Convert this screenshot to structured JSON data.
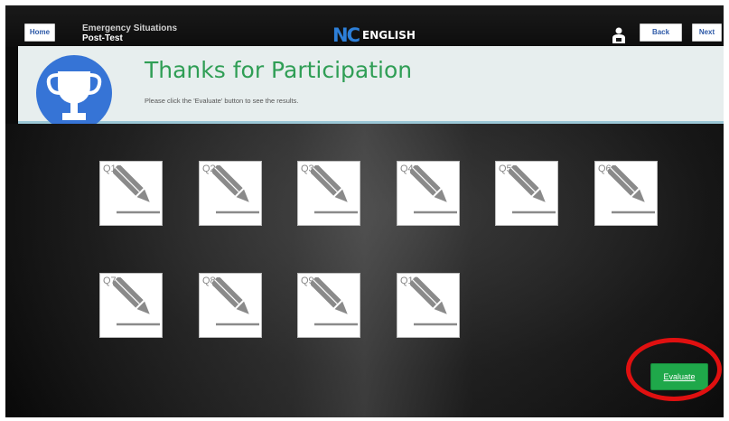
{
  "topbar": {
    "home_label": "Home",
    "course_title": "Emergency Situations",
    "course_sub": "Post-Test",
    "logo_mark": "NC",
    "logo_text": "ENGLISH",
    "back_label": "Back",
    "next_label": "Next"
  },
  "banner": {
    "title": "Thanks for Participation",
    "subtitle": "Please click the 'Evaluate' button to see the results."
  },
  "questions": [
    {
      "label": "Q1"
    },
    {
      "label": "Q2"
    },
    {
      "label": "Q3"
    },
    {
      "label": "Q4"
    },
    {
      "label": "Q5"
    },
    {
      "label": "Q6"
    },
    {
      "label": "Q7"
    },
    {
      "label": "Q8"
    },
    {
      "label": "Q9"
    },
    {
      "label": "Q10"
    }
  ],
  "evaluate_label": "Evaluate",
  "colors": {
    "accent_green": "#1fa84a",
    "title_green": "#2f9e55",
    "trophy_blue": "#3674d6",
    "highlight_red": "#e01010"
  },
  "icons": [
    "user-icon",
    "trophy-icon",
    "pencil-icon"
  ]
}
